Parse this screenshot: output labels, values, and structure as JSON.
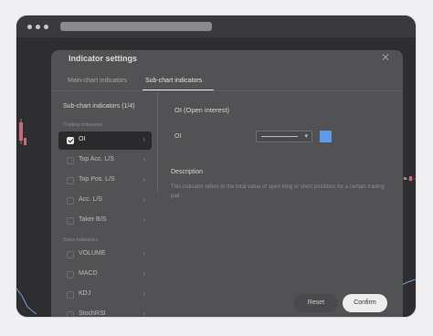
{
  "dialog": {
    "title": "Indicator settings",
    "close_icon": "close-icon",
    "tabs": [
      {
        "label": "Main-chart indicators",
        "active": false
      },
      {
        "label": "Sub-chart indicators",
        "active": true
      }
    ]
  },
  "sidebar": {
    "title": "Sub-chart indicators (1/4)",
    "groups": [
      {
        "label": "Trading indicators",
        "items": [
          {
            "label": "OI",
            "checked": true,
            "selected": true
          },
          {
            "label": "Top Acc. L/S",
            "checked": false
          },
          {
            "label": "Top Pos. L/S",
            "checked": false
          },
          {
            "label": "Acc. L/S",
            "checked": false
          },
          {
            "label": "Taker B/S",
            "checked": false
          }
        ]
      },
      {
        "label": "Basic indicators",
        "items": [
          {
            "label": "VOLUME",
            "checked": false
          },
          {
            "label": "MACD",
            "checked": false
          },
          {
            "label": "KDJ",
            "checked": false
          },
          {
            "label": "StochRSI",
            "checked": false
          }
        ]
      }
    ],
    "chevron_icon": "chevron-right-icon"
  },
  "detail": {
    "title": "OI (Open interest)",
    "field_label": "OI",
    "line_style": "solid",
    "line_color": "#5b9be8",
    "description_title": "Description",
    "description_text": "This indicator refers to the total value of open long or short positions for a certain trading pair"
  },
  "buttons": {
    "reset": "Reset",
    "confirm": "Confirm"
  }
}
